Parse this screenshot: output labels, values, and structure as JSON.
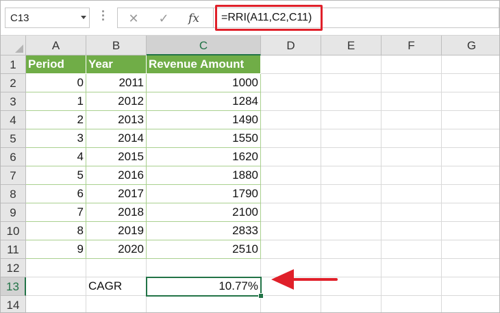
{
  "name_box": {
    "value": "C13"
  },
  "formula_bar": {
    "cancel_icon": "✕",
    "enter_icon": "✓",
    "fx_label": "fx",
    "formula": "=RRI(A11,C2,C11)"
  },
  "columns": [
    "A",
    "B",
    "C",
    "D",
    "E",
    "F",
    "G"
  ],
  "rows": [
    "1",
    "2",
    "3",
    "4",
    "5",
    "6",
    "7",
    "8",
    "9",
    "10",
    "11",
    "12",
    "13",
    "14"
  ],
  "table": {
    "headers": [
      "Period",
      "Year",
      "Revenue Amount"
    ],
    "data": [
      [
        "0",
        "2011",
        "1000"
      ],
      [
        "1",
        "2012",
        "1284"
      ],
      [
        "2",
        "2013",
        "1490"
      ],
      [
        "3",
        "2014",
        "1550"
      ],
      [
        "4",
        "2015",
        "1620"
      ],
      [
        "5",
        "2016",
        "1880"
      ],
      [
        "6",
        "2017",
        "1790"
      ],
      [
        "7",
        "2018",
        "2100"
      ],
      [
        "8",
        "2019",
        "2833"
      ],
      [
        "9",
        "2020",
        "2510"
      ]
    ]
  },
  "result": {
    "label": "CAGR",
    "value": "10.77%"
  },
  "colors": {
    "header_green": "#70ad47",
    "accent_green": "#217346",
    "highlight_red": "#e0202a"
  }
}
